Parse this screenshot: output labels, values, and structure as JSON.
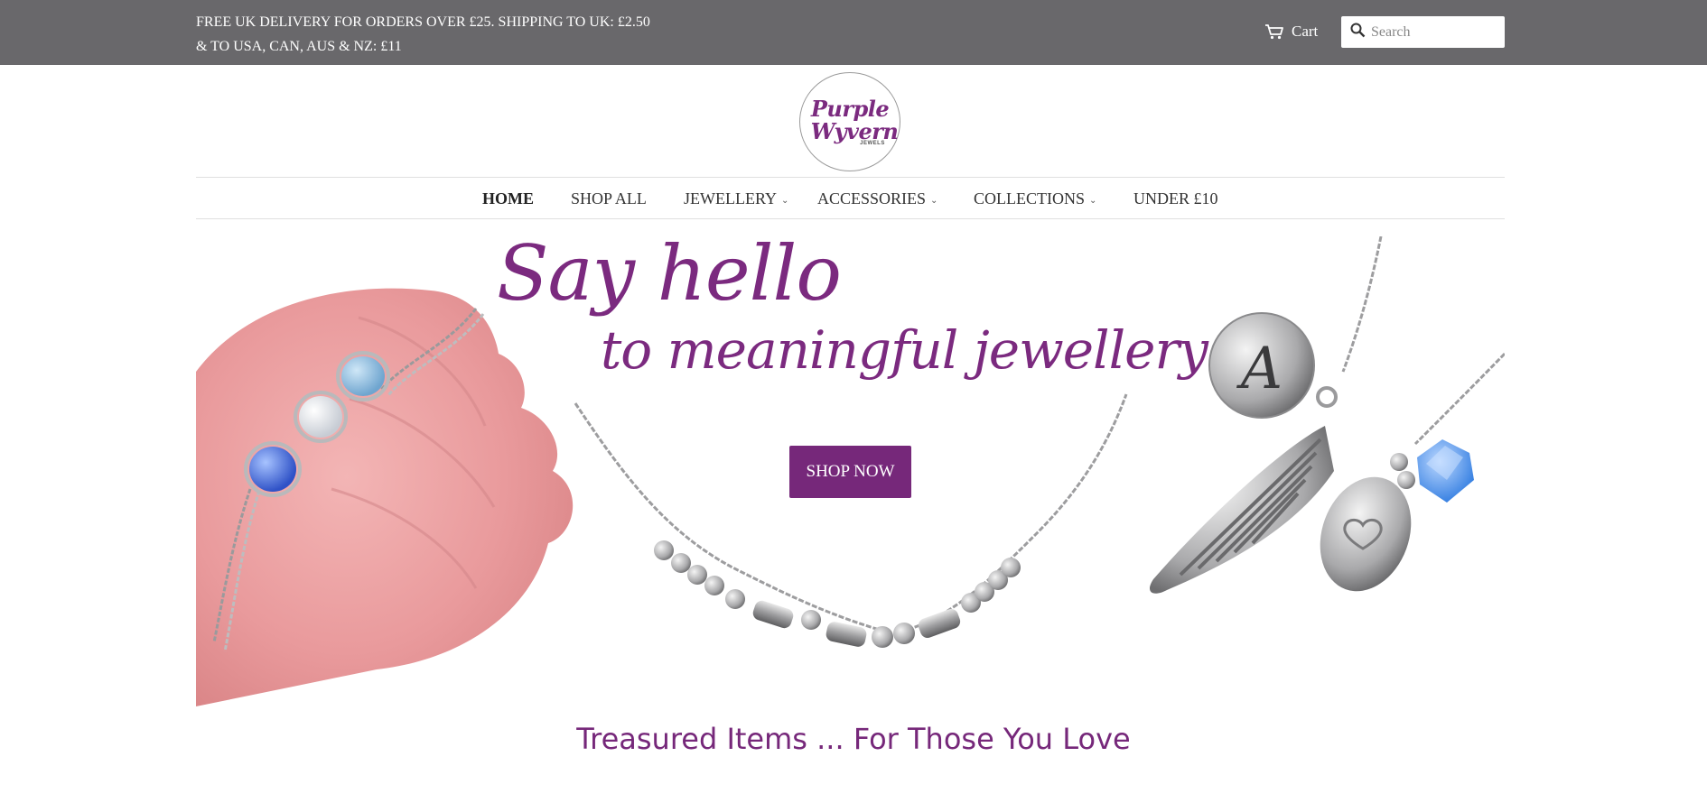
{
  "announcement": {
    "line1": "FREE UK DELIVERY FOR ORDERS OVER £25. SHIPPING TO UK: £2.50",
    "line2": "& TO USA, CAN, AUS & NZ: £11"
  },
  "header": {
    "cart_label": "Cart",
    "search_placeholder": "Search"
  },
  "logo": {
    "line1": "Purple",
    "line2": "Wyvern",
    "line3": "JEWELS"
  },
  "nav": {
    "items": [
      {
        "label": "HOME",
        "active": true,
        "dropdown": false
      },
      {
        "label": "SHOP ALL",
        "dropdown": false
      },
      {
        "label": "JEWELLERY",
        "dropdown": true
      },
      {
        "label": "ACCESSORIES",
        "dropdown": true
      },
      {
        "label": "COLLECTIONS",
        "dropdown": true
      },
      {
        "label": "UNDER £10",
        "dropdown": false
      }
    ]
  },
  "hero": {
    "heading_line1": "Say hello",
    "heading_line2": "to meaningful jewellery",
    "button_label": "SHOP NOW",
    "charm_letter": "A"
  },
  "tagline": "Treasured Items ... For Those You Love",
  "colors": {
    "topbar": "#69686b",
    "brand_purple": "#76287a"
  }
}
